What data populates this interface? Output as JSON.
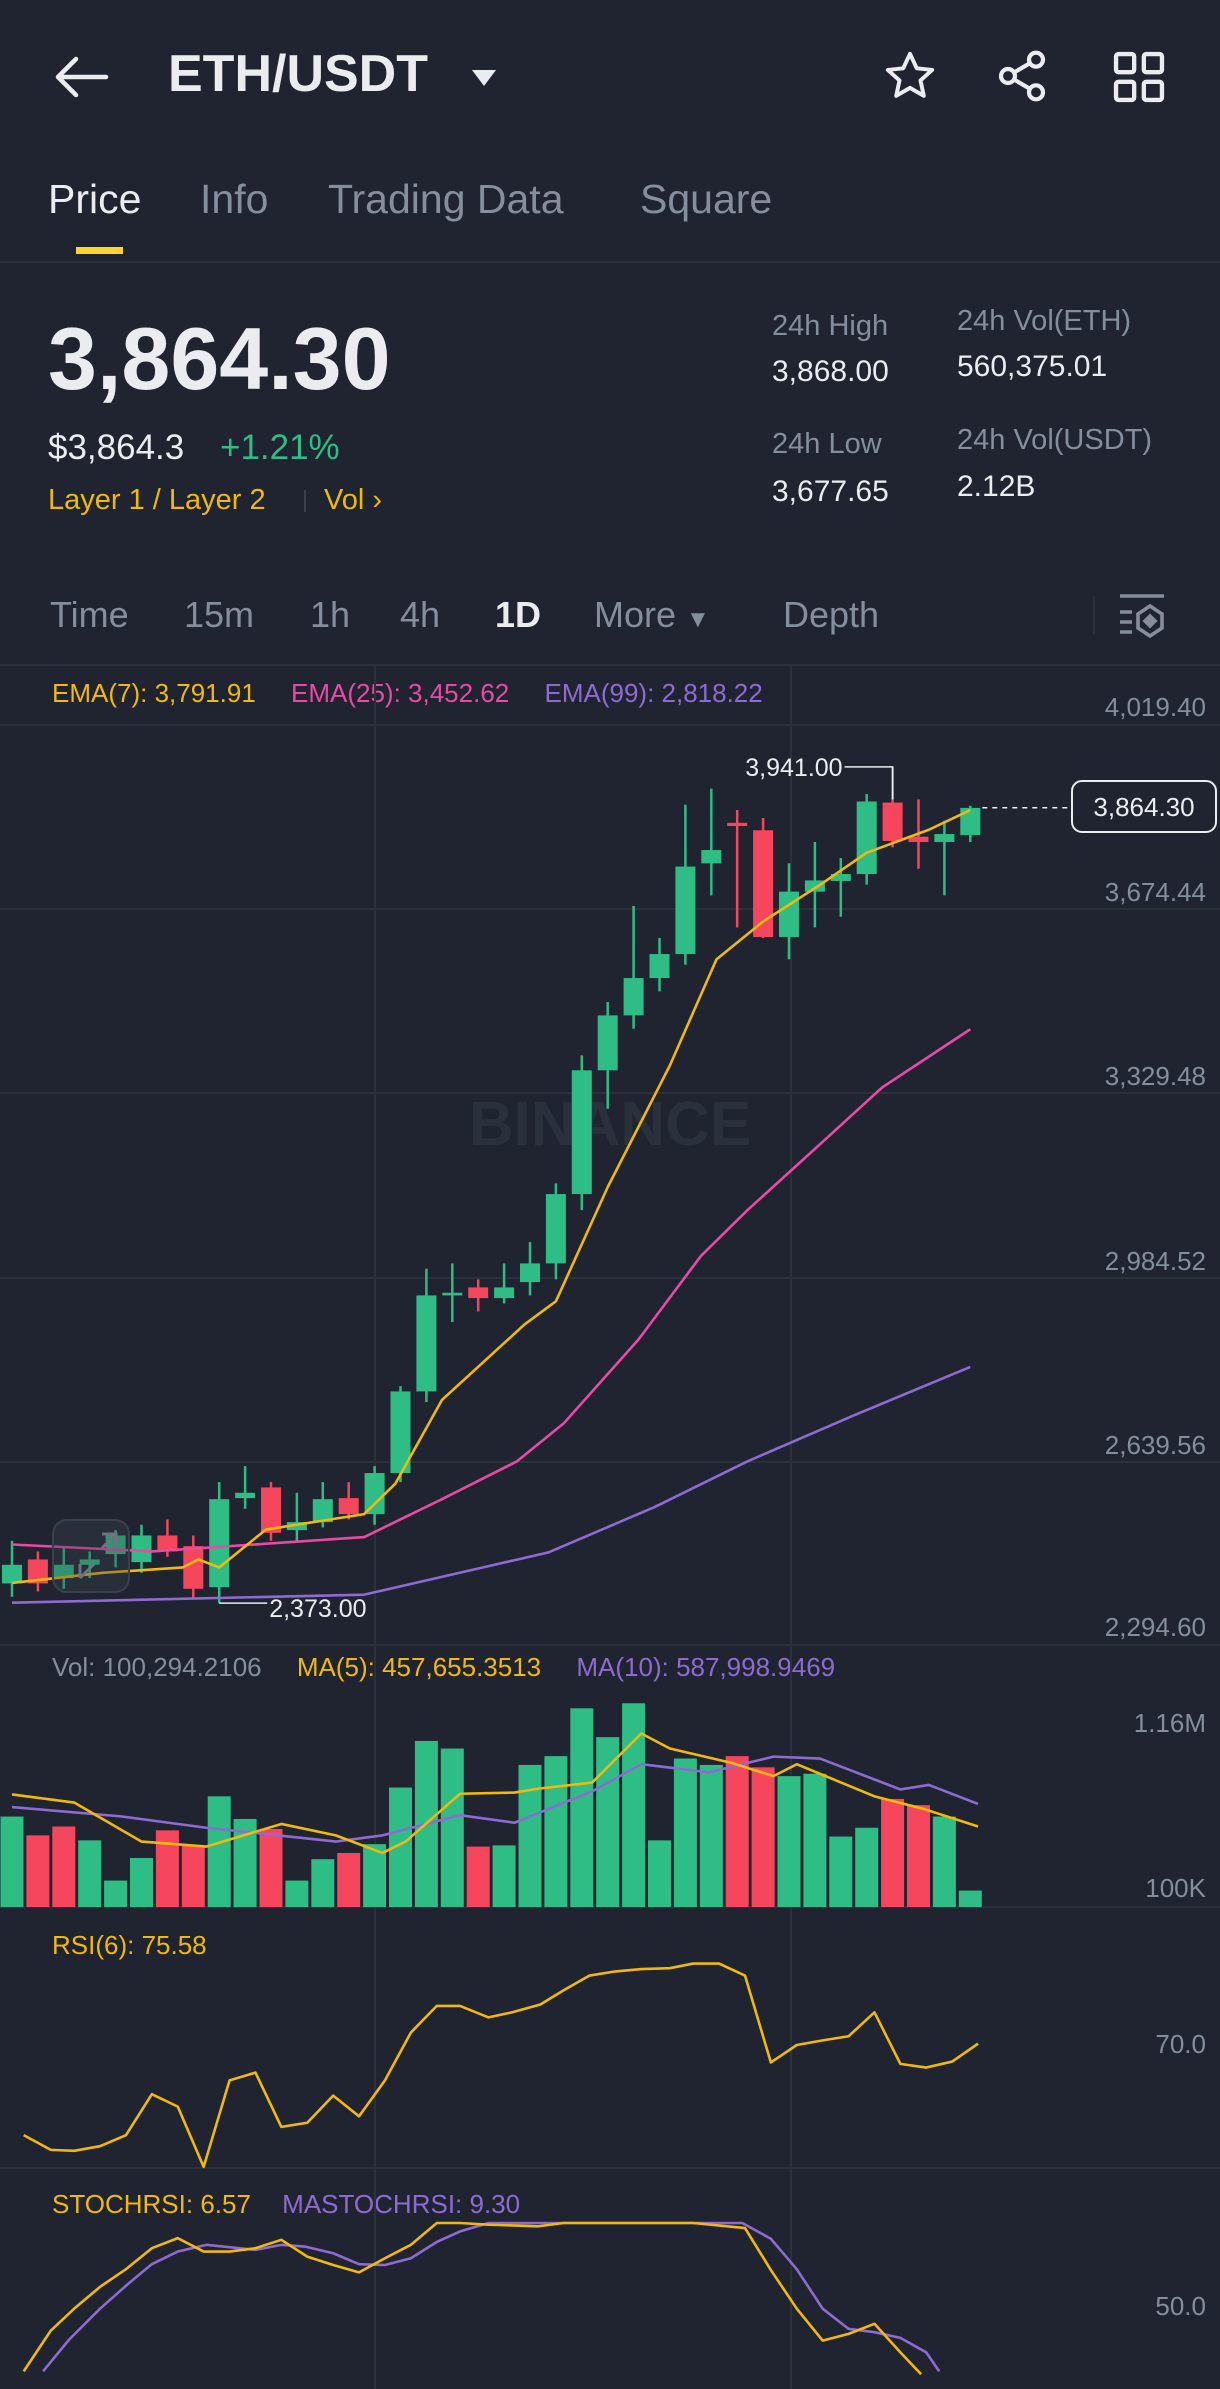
{
  "header": {
    "title": "ETH/USDT",
    "back_icon": "arrow-left-icon",
    "icons": [
      "star-icon",
      "share-icon",
      "grid-icon"
    ]
  },
  "tabs": [
    {
      "label": "Price",
      "active": true
    },
    {
      "label": "Info"
    },
    {
      "label": "Trading Data"
    },
    {
      "label": "Square"
    }
  ],
  "ticker": {
    "last_price": "3,864.30",
    "usd_price": "$3,864.3",
    "change": "+1.21%",
    "tags": "Layer 1 / Layer 2",
    "vol_link": "Vol",
    "stats": [
      {
        "label": "24h High",
        "value": "3,868.00"
      },
      {
        "label": "24h Vol(ETH)",
        "value": "560,375.01"
      },
      {
        "label": "24h Low",
        "value": "3,677.65"
      },
      {
        "label": "24h Vol(USDT)",
        "value": "2.12B"
      }
    ]
  },
  "intervals": [
    {
      "label": "Time"
    },
    {
      "label": "15m"
    },
    {
      "label": "1h"
    },
    {
      "label": "4h"
    },
    {
      "label": "1D",
      "active": true
    },
    {
      "label": "More"
    },
    {
      "label": "Depth"
    }
  ],
  "colors": {
    "up": "#2ebd85",
    "down": "#f6465d",
    "ema7": "#f0b90b",
    "ema25": "#e84aa6",
    "ema99": "#8e6bd1",
    "accent": "#fcd535"
  },
  "chart_data": {
    "type": "candlestick",
    "legend": {
      "ema7": "EMA(7): 3,791.91",
      "ema25": "EMA(25): 3,452.62",
      "ema99": "EMA(99): 2,818.22"
    },
    "price_ticks": [
      "4,019.40",
      "3,674.44",
      "3,329.48",
      "2,984.52",
      "2,639.56",
      "2,294.60"
    ],
    "price_range": [
      2294.6,
      4019.4
    ],
    "current_price": "3,864.30",
    "current_value": 3864.3,
    "high_marker": {
      "label": "3,941.00",
      "index": 34,
      "value": 3941
    },
    "low_marker": {
      "label": "2,373.00",
      "index": 8,
      "value": 2373
    },
    "watermark": "BINANCE",
    "candles": [
      [
        2410,
        2490,
        2385,
        2445
      ],
      [
        2455,
        2470,
        2395,
        2410
      ],
      [
        2420,
        2480,
        2400,
        2445
      ],
      [
        2445,
        2470,
        2420,
        2455
      ],
      [
        2465,
        2510,
        2440,
        2500
      ],
      [
        2450,
        2520,
        2430,
        2500
      ],
      [
        2500,
        2530,
        2460,
        2470
      ],
      [
        2480,
        2500,
        2380,
        2400
      ],
      [
        2403,
        2600,
        2373,
        2568
      ],
      [
        2570,
        2630,
        2550,
        2580
      ],
      [
        2590,
        2600,
        2490,
        2505
      ],
      [
        2510,
        2580,
        2490,
        2525
      ],
      [
        2525,
        2600,
        2515,
        2568
      ],
      [
        2570,
        2600,
        2530,
        2540
      ],
      [
        2540,
        2630,
        2520,
        2617
      ],
      [
        2617,
        2780,
        2600,
        2770
      ],
      [
        2770,
        3000,
        2750,
        2950
      ],
      [
        2950,
        3010,
        2900,
        2955
      ],
      [
        2965,
        2980,
        2920,
        2945
      ],
      [
        2945,
        3010,
        2935,
        2965
      ],
      [
        2975,
        3050,
        2950,
        3010
      ],
      [
        3010,
        3160,
        2980,
        3140
      ],
      [
        3140,
        3400,
        3110,
        3372
      ],
      [
        3372,
        3500,
        3300,
        3475
      ],
      [
        3475,
        3680,
        3450,
        3545
      ],
      [
        3545,
        3620,
        3520,
        3590
      ],
      [
        3590,
        3870,
        3570,
        3754
      ],
      [
        3760,
        3900,
        3700,
        3785
      ],
      [
        3836,
        3860,
        3640,
        3830
      ],
      [
        3822,
        3845,
        3620,
        3622
      ],
      [
        3622,
        3760,
        3580,
        3707
      ],
      [
        3707,
        3800,
        3640,
        3728
      ],
      [
        3727,
        3770,
        3660,
        3740
      ],
      [
        3740,
        3890,
        3720,
        3876
      ],
      [
        3874,
        3941,
        3790,
        3802
      ],
      [
        3810,
        3880,
        3750,
        3800
      ],
      [
        3800,
        3840,
        3700,
        3815
      ],
      [
        3813,
        3868,
        3800,
        3864
      ]
    ],
    "ema7": [
      [
        0,
        2411
      ],
      [
        3.5,
        2430
      ],
      [
        6.6,
        2440
      ],
      [
        7.2,
        2455
      ],
      [
        8,
        2440
      ],
      [
        9.8,
        2511
      ],
      [
        13.6,
        2540
      ],
      [
        14.8,
        2597
      ],
      [
        16.6,
        2754
      ],
      [
        19.8,
        2896
      ],
      [
        21,
        2939
      ],
      [
        23,
        3153
      ],
      [
        25.4,
        3381
      ],
      [
        27.2,
        3580
      ],
      [
        29,
        3651
      ],
      [
        31.3,
        3723
      ],
      [
        33,
        3780
      ],
      [
        35.4,
        3823
      ],
      [
        37,
        3860
      ]
    ],
    "ema25": [
      [
        0,
        2483
      ],
      [
        5.4,
        2470
      ],
      [
        13.6,
        2497
      ],
      [
        16.6,
        2568
      ],
      [
        19.5,
        2639
      ],
      [
        21.3,
        2710
      ],
      [
        24.2,
        2868
      ],
      [
        26.6,
        3024
      ],
      [
        28.4,
        3110
      ],
      [
        31.3,
        3238
      ],
      [
        33.6,
        3340
      ],
      [
        37,
        3449
      ]
    ],
    "ema99": [
      [
        0,
        2374
      ],
      [
        13.6,
        2389
      ],
      [
        20.7,
        2468
      ],
      [
        24.8,
        2553
      ],
      [
        28.4,
        2639
      ],
      [
        32.5,
        2725
      ],
      [
        37,
        2816
      ]
    ],
    "volume": {
      "legend": {
        "vol": "Vol: 100,294.2106",
        "ma5": "MA(5): 457,655.3513",
        "ma10": "MA(10): 587,998.9469"
      },
      "ticks": [
        "1.16M",
        "100K"
      ],
      "unit": "K",
      "range": [
        100,
        1160
      ],
      "values": [
        624,
        515,
        566,
        486,
        253,
        384,
        544,
        457,
        741,
        610,
        552,
        253,
        377,
        413,
        464,
        792,
        1062,
        1018,
        450,
        457,
        923,
        974,
        1251,
        1084,
        1280,
        486,
        960,
        923,
        974,
        909,
        858,
        872,
        508,
        559,
        726,
        690,
        624,
        195
      ],
      "down_indices": [
        1,
        2,
        6,
        7,
        10,
        13,
        18,
        28,
        29,
        34,
        35
      ],
      "ma5": [
        [
          0,
          752
        ],
        [
          2.4,
          705
        ],
        [
          5,
          479
        ],
        [
          7.5,
          450
        ],
        [
          10.4,
          581
        ],
        [
          12.5,
          515
        ],
        [
          14.3,
          413
        ],
        [
          15.2,
          479
        ],
        [
          17.3,
          756
        ],
        [
          19.4,
          763
        ],
        [
          20.3,
          785
        ],
        [
          22.4,
          821
        ],
        [
          24.3,
          1105
        ],
        [
          25.4,
          1018
        ],
        [
          27.8,
          934
        ],
        [
          29.4,
          858
        ],
        [
          30.3,
          927
        ],
        [
          33.3,
          741
        ],
        [
          35.2,
          668
        ],
        [
          37.3,
          566
        ]
      ],
      "ma10": [
        [
          0,
          679
        ],
        [
          4.2,
          625
        ],
        [
          7.5,
          559
        ],
        [
          12.5,
          479
        ],
        [
          14.3,
          515
        ],
        [
          17.3,
          632
        ],
        [
          19.4,
          588
        ],
        [
          22.4,
          770
        ],
        [
          24.3,
          927
        ],
        [
          26.9,
          880
        ],
        [
          29.4,
          971
        ],
        [
          31.2,
          960
        ],
        [
          34.3,
          781
        ],
        [
          35.4,
          807
        ],
        [
          37.3,
          697
        ]
      ]
    },
    "rsi": {
      "legend": "RSI(6): 75.58",
      "tick": "70.0",
      "tick_value": 70,
      "values": [
        [
          0.45,
          50.4
        ],
        [
          1.5,
          47.2
        ],
        [
          2.4,
          47
        ],
        [
          3.4,
          48
        ],
        [
          4.4,
          50.4
        ],
        [
          5.4,
          59.3
        ],
        [
          6.4,
          56.6
        ],
        [
          7.4,
          43.5
        ],
        [
          8.4,
          62.3
        ],
        [
          9.4,
          64
        ],
        [
          10.4,
          52.2
        ],
        [
          11.4,
          53.1
        ],
        [
          12.4,
          59
        ],
        [
          13.4,
          54.5
        ],
        [
          14.4,
          62.3
        ],
        [
          15.4,
          72.7
        ],
        [
          16.4,
          78.5
        ],
        [
          17.3,
          78.5
        ],
        [
          18.4,
          76
        ],
        [
          19.3,
          77.1
        ],
        [
          20.4,
          78.8
        ],
        [
          21.3,
          81.9
        ],
        [
          22.3,
          85.1
        ],
        [
          23.3,
          86
        ],
        [
          24.3,
          86.5
        ],
        [
          25.4,
          86.7
        ],
        [
          26.3,
          87.7
        ],
        [
          27.3,
          87.7
        ],
        [
          28.3,
          85.1
        ],
        [
          29.3,
          66.2
        ],
        [
          30.3,
          70
        ],
        [
          31.3,
          71
        ],
        [
          32.3,
          71.9
        ],
        [
          33.3,
          77.1
        ],
        [
          34.3,
          65.9
        ],
        [
          35.3,
          65.1
        ],
        [
          36.3,
          66.4
        ],
        [
          37.3,
          70.3
        ]
      ]
    },
    "stochrsi": {
      "legend_k": "STOCHRSI: 6.57",
      "legend_d": "MASTOCHRSI: 9.30",
      "tick": "50.0",
      "tick_value": 50,
      "k": [
        [
          0.45,
          11.7
        ],
        [
          1.5,
          36
        ],
        [
          2.4,
          49
        ],
        [
          3.4,
          62
        ],
        [
          4.4,
          72.5
        ],
        [
          5.4,
          85
        ],
        [
          6.4,
          91
        ],
        [
          7.4,
          83
        ],
        [
          8.4,
          83
        ],
        [
          9.4,
          85
        ],
        [
          10.4,
          90
        ],
        [
          11.4,
          80
        ],
        [
          12.4,
          75
        ],
        [
          13.4,
          70.6
        ],
        [
          14.4,
          79
        ],
        [
          15.4,
          87
        ],
        [
          16.4,
          100
        ],
        [
          17.3,
          100
        ],
        [
          18.4,
          99
        ],
        [
          20.3,
          98
        ],
        [
          21.3,
          100
        ],
        [
          26.3,
          100
        ],
        [
          28.3,
          97
        ],
        [
          29.3,
          72
        ],
        [
          30.3,
          49
        ],
        [
          31.3,
          30
        ],
        [
          32.3,
          34
        ],
        [
          33.3,
          40
        ],
        [
          34.3,
          23
        ],
        [
          35.1,
          10
        ]
      ],
      "d": [
        [
          1.2,
          11.7
        ],
        [
          2.2,
          30.5
        ],
        [
          3.4,
          49
        ],
        [
          4.5,
          64
        ],
        [
          5.4,
          75.5
        ],
        [
          6.4,
          83
        ],
        [
          7.5,
          87
        ],
        [
          9.4,
          84
        ],
        [
          10.4,
          87
        ],
        [
          11.3,
          86
        ],
        [
          12.4,
          82
        ],
        [
          13.4,
          75.5
        ],
        [
          14.4,
          75
        ],
        [
          15.4,
          79
        ],
        [
          16.4,
          88.7
        ],
        [
          17.3,
          95
        ],
        [
          18.4,
          100
        ],
        [
          28.2,
          100
        ],
        [
          29.3,
          90.6
        ],
        [
          30.3,
          72.5
        ],
        [
          31.3,
          49
        ],
        [
          32.3,
          37
        ],
        [
          33.3,
          35
        ],
        [
          34.3,
          31.6
        ],
        [
          35.3,
          23
        ],
        [
          35.8,
          11.7
        ]
      ]
    }
  }
}
